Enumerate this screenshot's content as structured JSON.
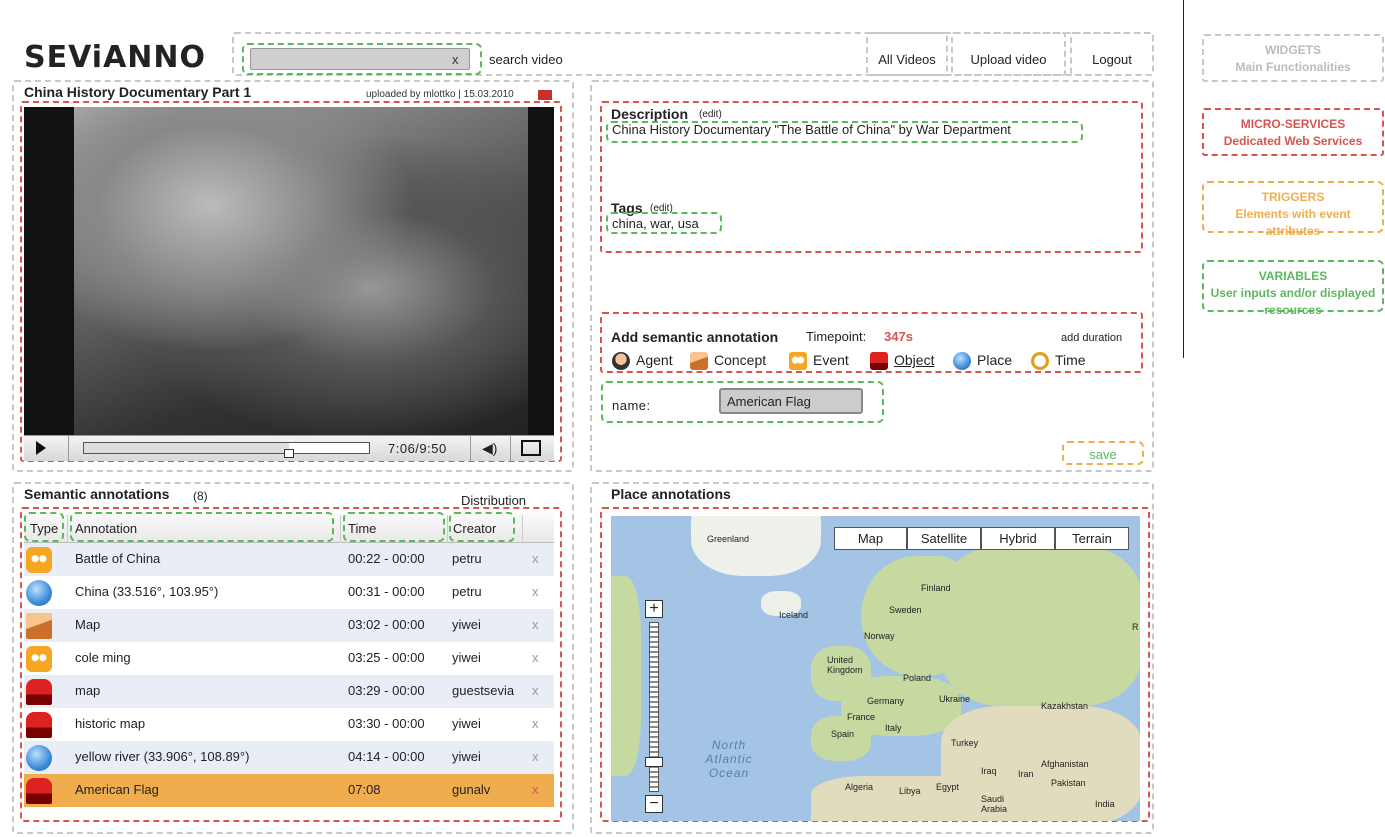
{
  "app": {
    "logo": "SEViANNO"
  },
  "search": {
    "value": "",
    "clear": "x",
    "label": "search video"
  },
  "nav": {
    "all_videos": "All Videos",
    "upload": "Upload video",
    "logout": "Logout"
  },
  "legend": {
    "widgets": {
      "title": "WIDGETS",
      "desc": "Main Functionalities",
      "color": "#c8c8c8"
    },
    "micro": {
      "title": "MICRO-SERVICES",
      "desc": "Dedicated Web Services",
      "color": "#d9534f"
    },
    "triggers": {
      "title": "TRIGGERS",
      "desc": "Elements with event attributes",
      "color": "#f0ad4e"
    },
    "variables": {
      "title": "VARIABLES",
      "desc": "User inputs and/or displayed resources",
      "color": "#5cb85c"
    }
  },
  "video": {
    "title": "China History Documentary Part 1",
    "meta": "uploaded by mlottko | 15.03.2010",
    "time": "7:06/9:50",
    "progress": 0.72
  },
  "description": {
    "title": "Description",
    "edit": "(edit)",
    "value": "China History Documentary \"The Battle of China\" by War Department"
  },
  "tags": {
    "title": "Tags",
    "edit": "(edit)",
    "value": "china, war, usa"
  },
  "add_annotation": {
    "title": "Add semantic annotation",
    "timepoint_label": "Timepoint:",
    "timepoint_value": "347s",
    "add_duration": "add duration",
    "types": [
      {
        "label": "Agent",
        "icon": "agent-icon"
      },
      {
        "label": "Concept",
        "icon": "concept-icon"
      },
      {
        "label": "Event",
        "icon": "event-icon"
      },
      {
        "label": "Object",
        "icon": "object-icon"
      },
      {
        "label": "Place",
        "icon": "place-icon"
      },
      {
        "label": "Time",
        "icon": "time-icon"
      }
    ],
    "selected_type": "Object",
    "name_label": "name:",
    "name_value": "American Flag",
    "save": "save"
  },
  "semantic": {
    "title": "Semantic annotations",
    "count": "(8)",
    "distribution": "Distribution",
    "headers": {
      "type": "Type",
      "annotation": "Annotation",
      "time": "Time",
      "creator": "Creator"
    },
    "rows": [
      {
        "type": "event-icon",
        "annotation": "Battle of China",
        "time": "00:22 - 00:00",
        "creator": "petru",
        "delete": "x"
      },
      {
        "type": "place-icon",
        "annotation": "China (33.516°, 103.95°)",
        "time": "00:31 - 00:00",
        "creator": "petru",
        "delete": "x"
      },
      {
        "type": "concept-icon",
        "annotation": "Map",
        "time": "03:02 - 00:00",
        "creator": "yiwei",
        "delete": "x"
      },
      {
        "type": "event-icon",
        "annotation": "cole ming",
        "time": "03:25 - 00:00",
        "creator": "yiwei",
        "delete": "x"
      },
      {
        "type": "object-icon",
        "annotation": "map",
        "time": "03:29 - 00:00",
        "creator": "guestsevia",
        "delete": "x"
      },
      {
        "type": "object-icon",
        "annotation": "historic map",
        "time": "03:30 - 00:00",
        "creator": "yiwei",
        "delete": "x"
      },
      {
        "type": "place-icon",
        "annotation": "yellow river (33.906°, 108.89°)",
        "time": "04:14 - 00:00",
        "creator": "yiwei",
        "delete": "x"
      },
      {
        "type": "object-icon",
        "annotation": "American Flag",
        "time": "07:08",
        "creator": "gunalv",
        "delete": "x"
      }
    ],
    "selected_row": 7
  },
  "map": {
    "title": "Place annotations",
    "types": [
      "Map",
      "Satellite",
      "Hybrid",
      "Terrain"
    ],
    "zoom_plus": "+",
    "zoom_minus": "−",
    "labels": [
      "Greenland",
      "Iceland",
      "Finland",
      "Sweden",
      "Norway",
      "United Kingdom",
      "Poland",
      "Germany",
      "Ukraine",
      "Kazakhstan",
      "France",
      "Italy",
      "Spain",
      "Turkey",
      "Algeria",
      "Libya",
      "Egypt",
      "Iraq",
      "Iran",
      "Afghanistan",
      "Pakistan",
      "Saudi Arabia",
      "India",
      "North Atlantic Ocean",
      "R"
    ]
  }
}
